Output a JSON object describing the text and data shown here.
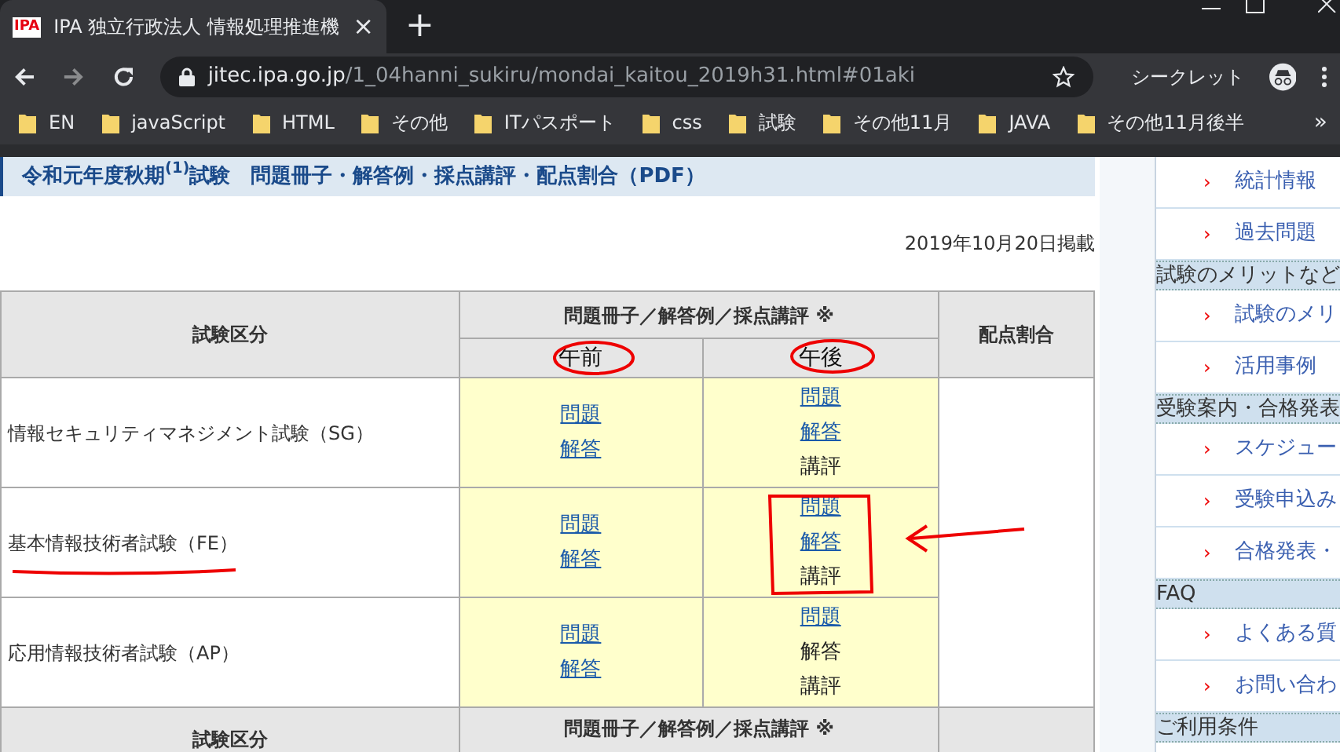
{
  "tab": {
    "favicon_text": "IPA",
    "title": "IPA 独立行政法人 情報処理推進機",
    "close": "×",
    "new_tab": "+"
  },
  "address_bar": {
    "host": "jitec.ipa.go.jp",
    "path": "/1_04hanni_sukiru/mondai_kaitou_2019h31.html#01aki"
  },
  "profile": {
    "label": "シークレット"
  },
  "bookmarks": [
    "EN",
    "javaScript",
    "HTML",
    "その他",
    "ITパスポート",
    "css",
    "試験",
    "その他11月",
    "JAVA",
    "その他11月後半"
  ],
  "bookmarks_more": "»",
  "heading": {
    "text": "令和元年度秋期$^{(1)}$試験　問題冊子・解答例・採点講評・配点割合（PDF）"
  },
  "posted_date": "2019年10月20日掲載",
  "table": {
    "columns": [
      "試験区分",
      "問題冊子／解答例／採点講評 ※",
      "配点割合"
    ],
    "subcolumns": [
      "午前",
      "午後"
    ],
    "rows": [
      {
        "exam": "情報セキュリティマネジメント試験（SG）",
        "am": [
          {
            "label": "問題",
            "link": true
          },
          {
            "label": "解答",
            "link": true
          }
        ],
        "pm": [
          {
            "label": "問題",
            "link": true
          },
          {
            "label": "解答",
            "link": true
          },
          {
            "label": "講評",
            "link": false
          }
        ]
      },
      {
        "exam": "基本情報技術者試験（FE）",
        "am": [
          {
            "label": "問題",
            "link": true
          },
          {
            "label": "解答",
            "link": true
          }
        ],
        "pm": [
          {
            "label": "問題",
            "link": true
          },
          {
            "label": "解答",
            "link": true
          },
          {
            "label": "講評",
            "link": false
          }
        ]
      },
      {
        "exam": "応用情報技術者試験（AP）",
        "am": [
          {
            "label": "問題",
            "link": true
          },
          {
            "label": "解答",
            "link": true
          }
        ],
        "pm": [
          {
            "label": "問題",
            "link": true
          },
          {
            "label": "解答",
            "link": false
          },
          {
            "label": "講評",
            "link": false
          }
        ]
      }
    ],
    "repeated_header": [
      "試験区分",
      "問題冊子／解答例／採点講評 ※"
    ]
  },
  "sidebar": [
    {
      "kind": "item",
      "label": "統計情報"
    },
    {
      "kind": "item",
      "label": "過去問題"
    },
    {
      "kind": "header",
      "label": "試験のメリットなど"
    },
    {
      "kind": "item",
      "label": "試験のメリ"
    },
    {
      "kind": "item",
      "label": "活用事例"
    },
    {
      "kind": "header",
      "label": "受験案内・合格発表"
    },
    {
      "kind": "item",
      "label": "スケジュー"
    },
    {
      "kind": "item",
      "label": "受験申込み"
    },
    {
      "kind": "item",
      "label": "合格発表・"
    },
    {
      "kind": "header",
      "label": "FAQ"
    },
    {
      "kind": "item",
      "label": "よくある質"
    },
    {
      "kind": "item",
      "label": "お問い合わ"
    },
    {
      "kind": "header",
      "label": "ご利用条件"
    }
  ],
  "sidebar_marker": "›"
}
